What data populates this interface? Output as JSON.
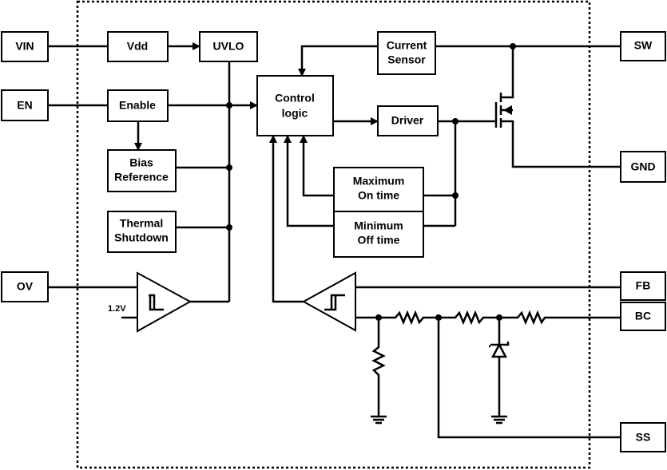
{
  "pins": {
    "vin": "VIN",
    "en": "EN",
    "ov": "OV",
    "sw": "SW",
    "gnd": "GND",
    "fb": "FB",
    "bc": "BC",
    "ss": "SS"
  },
  "blocks": {
    "vdd": "Vdd",
    "uvlo": "UVLO",
    "enable": "Enable",
    "bias_line1": "Bias",
    "bias_line2": "Reference",
    "thermal_line1": "Thermal",
    "thermal_line2": "Shutdown",
    "control_line1": "Control",
    "control_line2": "logic",
    "current_line1": "Current",
    "current_line2": "Sensor",
    "driver": "Driver",
    "maxon_line1": "Maximum",
    "maxon_line2": "On time",
    "minoff_line1": "Minimum",
    "minoff_line2": "Off time"
  },
  "ov_reference": "1.2V",
  "colors": {
    "line": "#000000",
    "background": "#ffffff"
  }
}
